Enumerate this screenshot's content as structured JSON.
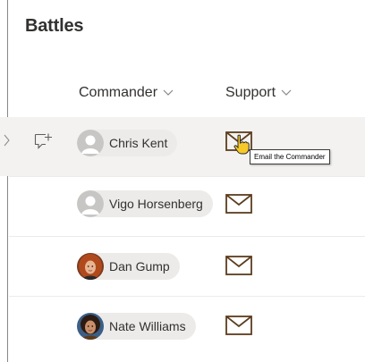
{
  "page": {
    "title": "Battles"
  },
  "columns": {
    "commander": "Commander",
    "support": "Support"
  },
  "rows": [
    {
      "name": "Chris Kent",
      "avatar": "placeholder-person-icon",
      "selected": true
    },
    {
      "name": "Vigo Horsenberg",
      "avatar": "placeholder-person-icon",
      "selected": false
    },
    {
      "name": "Dan Gump",
      "avatar": "photo-red-hair",
      "selected": false
    },
    {
      "name": "Nate Williams",
      "avatar": "photo-dark-hair",
      "selected": false
    }
  ],
  "tooltip": {
    "text": "Email the Commander"
  },
  "icons": {
    "support": "mail-icon",
    "row_action": "comment-add-icon",
    "sort": "chevron-down-icon"
  },
  "colors": {
    "mail_icon": "#5c3d1e",
    "selected_row": "#f3f2f1",
    "persona_bg": "#edebe9"
  }
}
